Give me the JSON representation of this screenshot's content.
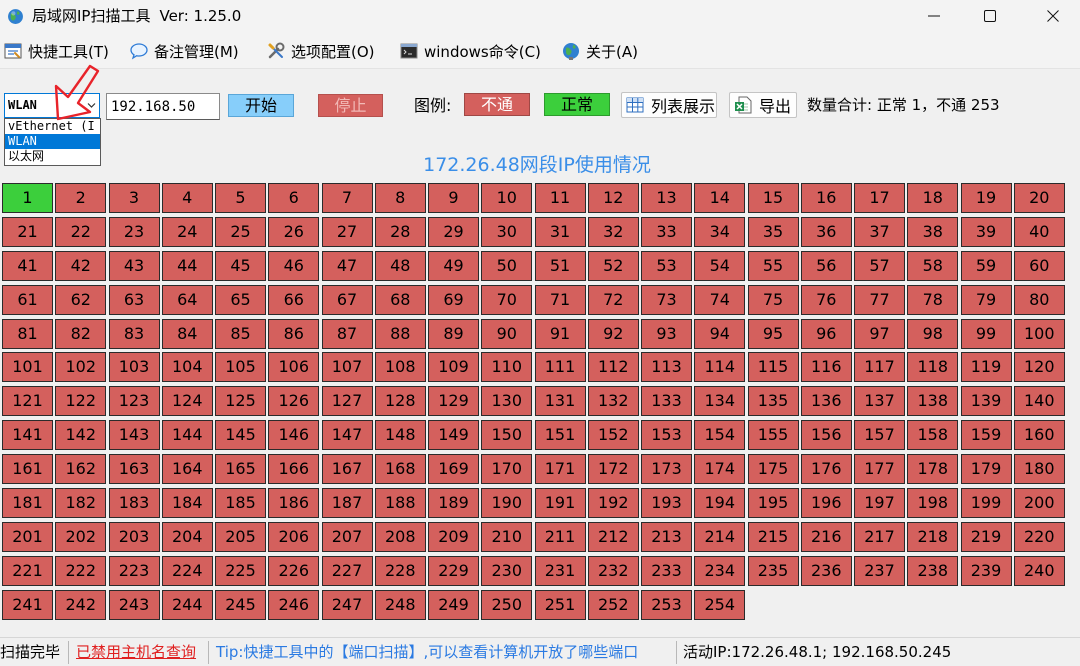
{
  "window": {
    "title": "局域网IP扫描工具",
    "version": "Ver: 1.25.0"
  },
  "menu": {
    "items": [
      {
        "label": "快捷工具(T)",
        "icon": "toolbox-icon"
      },
      {
        "label": "备注管理(M)",
        "icon": "speech-bubble-icon"
      },
      {
        "label": "选项配置(O)",
        "icon": "tools-icon"
      },
      {
        "label": "windows命令(C)",
        "icon": "console-icon"
      },
      {
        "label": "关于(A)",
        "icon": "globe-icon"
      }
    ]
  },
  "toolbar": {
    "adapter": {
      "selected": "WLAN",
      "options": [
        "vEthernet (I",
        "WLAN",
        "以太网"
      ],
      "highlighted_index": 1
    },
    "ip_prefix": "192.168.50",
    "start_label": "开始",
    "stop_label": "停止",
    "legend": {
      "label": "图例:",
      "down_label": "不通",
      "up_label": "正常"
    },
    "list_view_label": "列表展示",
    "list_view_icon": "table-grid-icon",
    "export_label": "导出",
    "export_icon": "excel-export-icon",
    "count_summary": "数量合计: 正常 1，不通 253"
  },
  "section_title": "172.26.48网段IP使用情况",
  "grid": {
    "cells": [
      {
        "n": 1,
        "up": true
      },
      {
        "n": 2,
        "up": false
      },
      {
        "n": 3,
        "up": false
      },
      {
        "n": 4,
        "up": false
      },
      {
        "n": 5,
        "up": false
      },
      {
        "n": 6,
        "up": false
      },
      {
        "n": 7,
        "up": false
      },
      {
        "n": 8,
        "up": false
      },
      {
        "n": 9,
        "up": false
      },
      {
        "n": 10,
        "up": false
      },
      {
        "n": 11,
        "up": false
      },
      {
        "n": 12,
        "up": false
      },
      {
        "n": 13,
        "up": false
      },
      {
        "n": 14,
        "up": false
      },
      {
        "n": 15,
        "up": false
      },
      {
        "n": 16,
        "up": false
      },
      {
        "n": 17,
        "up": false
      },
      {
        "n": 18,
        "up": false
      },
      {
        "n": 19,
        "up": false
      },
      {
        "n": 20,
        "up": false
      },
      {
        "n": 21,
        "up": false
      },
      {
        "n": 22,
        "up": false
      },
      {
        "n": 23,
        "up": false
      },
      {
        "n": 24,
        "up": false
      },
      {
        "n": 25,
        "up": false
      },
      {
        "n": 26,
        "up": false
      },
      {
        "n": 27,
        "up": false
      },
      {
        "n": 28,
        "up": false
      },
      {
        "n": 29,
        "up": false
      },
      {
        "n": 30,
        "up": false
      },
      {
        "n": 31,
        "up": false
      },
      {
        "n": 32,
        "up": false
      },
      {
        "n": 33,
        "up": false
      },
      {
        "n": 34,
        "up": false
      },
      {
        "n": 35,
        "up": false
      },
      {
        "n": 36,
        "up": false
      },
      {
        "n": 37,
        "up": false
      },
      {
        "n": 38,
        "up": false
      },
      {
        "n": 39,
        "up": false
      },
      {
        "n": 40,
        "up": false
      },
      {
        "n": 41,
        "up": false
      },
      {
        "n": 42,
        "up": false
      },
      {
        "n": 43,
        "up": false
      },
      {
        "n": 44,
        "up": false
      },
      {
        "n": 45,
        "up": false
      },
      {
        "n": 46,
        "up": false
      },
      {
        "n": 47,
        "up": false
      },
      {
        "n": 48,
        "up": false
      },
      {
        "n": 49,
        "up": false
      },
      {
        "n": 50,
        "up": false
      },
      {
        "n": 51,
        "up": false
      },
      {
        "n": 52,
        "up": false
      },
      {
        "n": 53,
        "up": false
      },
      {
        "n": 54,
        "up": false
      },
      {
        "n": 55,
        "up": false
      },
      {
        "n": 56,
        "up": false
      },
      {
        "n": 57,
        "up": false
      },
      {
        "n": 58,
        "up": false
      },
      {
        "n": 59,
        "up": false
      },
      {
        "n": 60,
        "up": false
      },
      {
        "n": 61,
        "up": false
      },
      {
        "n": 62,
        "up": false
      },
      {
        "n": 63,
        "up": false
      },
      {
        "n": 64,
        "up": false
      },
      {
        "n": 65,
        "up": false
      },
      {
        "n": 66,
        "up": false
      },
      {
        "n": 67,
        "up": false
      },
      {
        "n": 68,
        "up": false
      },
      {
        "n": 69,
        "up": false
      },
      {
        "n": 70,
        "up": false
      },
      {
        "n": 71,
        "up": false
      },
      {
        "n": 72,
        "up": false
      },
      {
        "n": 73,
        "up": false
      },
      {
        "n": 74,
        "up": false
      },
      {
        "n": 75,
        "up": false
      },
      {
        "n": 76,
        "up": false
      },
      {
        "n": 77,
        "up": false
      },
      {
        "n": 78,
        "up": false
      },
      {
        "n": 79,
        "up": false
      },
      {
        "n": 80,
        "up": false
      },
      {
        "n": 81,
        "up": false
      },
      {
        "n": 82,
        "up": false
      },
      {
        "n": 83,
        "up": false
      },
      {
        "n": 84,
        "up": false
      },
      {
        "n": 85,
        "up": false
      },
      {
        "n": 86,
        "up": false
      },
      {
        "n": 87,
        "up": false
      },
      {
        "n": 88,
        "up": false
      },
      {
        "n": 89,
        "up": false
      },
      {
        "n": 90,
        "up": false
      },
      {
        "n": 91,
        "up": false
      },
      {
        "n": 92,
        "up": false
      },
      {
        "n": 93,
        "up": false
      },
      {
        "n": 94,
        "up": false
      },
      {
        "n": 95,
        "up": false
      },
      {
        "n": 96,
        "up": false
      },
      {
        "n": 97,
        "up": false
      },
      {
        "n": 98,
        "up": false
      },
      {
        "n": 99,
        "up": false
      },
      {
        "n": 100,
        "up": false
      },
      {
        "n": 101,
        "up": false
      },
      {
        "n": 102,
        "up": false
      },
      {
        "n": 103,
        "up": false
      },
      {
        "n": 104,
        "up": false
      },
      {
        "n": 105,
        "up": false
      },
      {
        "n": 106,
        "up": false
      },
      {
        "n": 107,
        "up": false
      },
      {
        "n": 108,
        "up": false
      },
      {
        "n": 109,
        "up": false
      },
      {
        "n": 110,
        "up": false
      },
      {
        "n": 111,
        "up": false
      },
      {
        "n": 112,
        "up": false
      },
      {
        "n": 113,
        "up": false
      },
      {
        "n": 114,
        "up": false
      },
      {
        "n": 115,
        "up": false
      },
      {
        "n": 116,
        "up": false
      },
      {
        "n": 117,
        "up": false
      },
      {
        "n": 118,
        "up": false
      },
      {
        "n": 119,
        "up": false
      },
      {
        "n": 120,
        "up": false
      },
      {
        "n": 121,
        "up": false
      },
      {
        "n": 122,
        "up": false
      },
      {
        "n": 123,
        "up": false
      },
      {
        "n": 124,
        "up": false
      },
      {
        "n": 125,
        "up": false
      },
      {
        "n": 126,
        "up": false
      },
      {
        "n": 127,
        "up": false
      },
      {
        "n": 128,
        "up": false
      },
      {
        "n": 129,
        "up": false
      },
      {
        "n": 130,
        "up": false
      },
      {
        "n": 131,
        "up": false
      },
      {
        "n": 132,
        "up": false
      },
      {
        "n": 133,
        "up": false
      },
      {
        "n": 134,
        "up": false
      },
      {
        "n": 135,
        "up": false
      },
      {
        "n": 136,
        "up": false
      },
      {
        "n": 137,
        "up": false
      },
      {
        "n": 138,
        "up": false
      },
      {
        "n": 139,
        "up": false
      },
      {
        "n": 140,
        "up": false
      },
      {
        "n": 141,
        "up": false
      },
      {
        "n": 142,
        "up": false
      },
      {
        "n": 143,
        "up": false
      },
      {
        "n": 144,
        "up": false
      },
      {
        "n": 145,
        "up": false
      },
      {
        "n": 146,
        "up": false
      },
      {
        "n": 147,
        "up": false
      },
      {
        "n": 148,
        "up": false
      },
      {
        "n": 149,
        "up": false
      },
      {
        "n": 150,
        "up": false
      },
      {
        "n": 151,
        "up": false
      },
      {
        "n": 152,
        "up": false
      },
      {
        "n": 153,
        "up": false
      },
      {
        "n": 154,
        "up": false
      },
      {
        "n": 155,
        "up": false
      },
      {
        "n": 156,
        "up": false
      },
      {
        "n": 157,
        "up": false
      },
      {
        "n": 158,
        "up": false
      },
      {
        "n": 159,
        "up": false
      },
      {
        "n": 160,
        "up": false
      },
      {
        "n": 161,
        "up": false
      },
      {
        "n": 162,
        "up": false
      },
      {
        "n": 163,
        "up": false
      },
      {
        "n": 164,
        "up": false
      },
      {
        "n": 165,
        "up": false
      },
      {
        "n": 166,
        "up": false
      },
      {
        "n": 167,
        "up": false
      },
      {
        "n": 168,
        "up": false
      },
      {
        "n": 169,
        "up": false
      },
      {
        "n": 170,
        "up": false
      },
      {
        "n": 171,
        "up": false
      },
      {
        "n": 172,
        "up": false
      },
      {
        "n": 173,
        "up": false
      },
      {
        "n": 174,
        "up": false
      },
      {
        "n": 175,
        "up": false
      },
      {
        "n": 176,
        "up": false
      },
      {
        "n": 177,
        "up": false
      },
      {
        "n": 178,
        "up": false
      },
      {
        "n": 179,
        "up": false
      },
      {
        "n": 180,
        "up": false
      },
      {
        "n": 181,
        "up": false
      },
      {
        "n": 182,
        "up": false
      },
      {
        "n": 183,
        "up": false
      },
      {
        "n": 184,
        "up": false
      },
      {
        "n": 185,
        "up": false
      },
      {
        "n": 186,
        "up": false
      },
      {
        "n": 187,
        "up": false
      },
      {
        "n": 188,
        "up": false
      },
      {
        "n": 189,
        "up": false
      },
      {
        "n": 190,
        "up": false
      },
      {
        "n": 191,
        "up": false
      },
      {
        "n": 192,
        "up": false
      },
      {
        "n": 193,
        "up": false
      },
      {
        "n": 194,
        "up": false
      },
      {
        "n": 195,
        "up": false
      },
      {
        "n": 196,
        "up": false
      },
      {
        "n": 197,
        "up": false
      },
      {
        "n": 198,
        "up": false
      },
      {
        "n": 199,
        "up": false
      },
      {
        "n": 200,
        "up": false
      },
      {
        "n": 201,
        "up": false
      },
      {
        "n": 202,
        "up": false
      },
      {
        "n": 203,
        "up": false
      },
      {
        "n": 204,
        "up": false
      },
      {
        "n": 205,
        "up": false
      },
      {
        "n": 206,
        "up": false
      },
      {
        "n": 207,
        "up": false
      },
      {
        "n": 208,
        "up": false
      },
      {
        "n": 209,
        "up": false
      },
      {
        "n": 210,
        "up": false
      },
      {
        "n": 211,
        "up": false
      },
      {
        "n": 212,
        "up": false
      },
      {
        "n": 213,
        "up": false
      },
      {
        "n": 214,
        "up": false
      },
      {
        "n": 215,
        "up": false
      },
      {
        "n": 216,
        "up": false
      },
      {
        "n": 217,
        "up": false
      },
      {
        "n": 218,
        "up": false
      },
      {
        "n": 219,
        "up": false
      },
      {
        "n": 220,
        "up": false
      },
      {
        "n": 221,
        "up": false
      },
      {
        "n": 222,
        "up": false
      },
      {
        "n": 223,
        "up": false
      },
      {
        "n": 224,
        "up": false
      },
      {
        "n": 225,
        "up": false
      },
      {
        "n": 226,
        "up": false
      },
      {
        "n": 227,
        "up": false
      },
      {
        "n": 228,
        "up": false
      },
      {
        "n": 229,
        "up": false
      },
      {
        "n": 230,
        "up": false
      },
      {
        "n": 231,
        "up": false
      },
      {
        "n": 232,
        "up": false
      },
      {
        "n": 233,
        "up": false
      },
      {
        "n": 234,
        "up": false
      },
      {
        "n": 235,
        "up": false
      },
      {
        "n": 236,
        "up": false
      },
      {
        "n": 237,
        "up": false
      },
      {
        "n": 238,
        "up": false
      },
      {
        "n": 239,
        "up": false
      },
      {
        "n": 240,
        "up": false
      },
      {
        "n": 241,
        "up": false
      },
      {
        "n": 242,
        "up": false
      },
      {
        "n": 243,
        "up": false
      },
      {
        "n": 244,
        "up": false
      },
      {
        "n": 245,
        "up": false
      },
      {
        "n": 246,
        "up": false
      },
      {
        "n": 247,
        "up": false
      },
      {
        "n": 248,
        "up": false
      },
      {
        "n": 249,
        "up": false
      },
      {
        "n": 250,
        "up": false
      },
      {
        "n": 251,
        "up": false
      },
      {
        "n": 252,
        "up": false
      },
      {
        "n": 253,
        "up": false
      },
      {
        "n": 254,
        "up": false
      }
    ]
  },
  "status_bar": {
    "scan_state": "扫描完毕",
    "hostname_lookup": "已禁用主机名查询",
    "tip": "Tip:快捷工具中的【端口扫描】,可以查看计算机开放了哪些端口",
    "active_ip": "活动IP:172.26.48.1; 192.168.50.245"
  },
  "colors": {
    "window_bg": "#f0f0f0",
    "titlebar_bg": "#f3f3f3",
    "down": "#d4605d",
    "up": "#3ccf3c",
    "cell_border": "#2b2b2b",
    "start_bg": "#87cefa",
    "stop_bg": "#d4605d",
    "title_blue": "#3a8ee8",
    "tip_blue": "#2a7ae2",
    "link_red": "#e02020",
    "highlight": "#0078d7",
    "annotation": "#e8232a"
  }
}
